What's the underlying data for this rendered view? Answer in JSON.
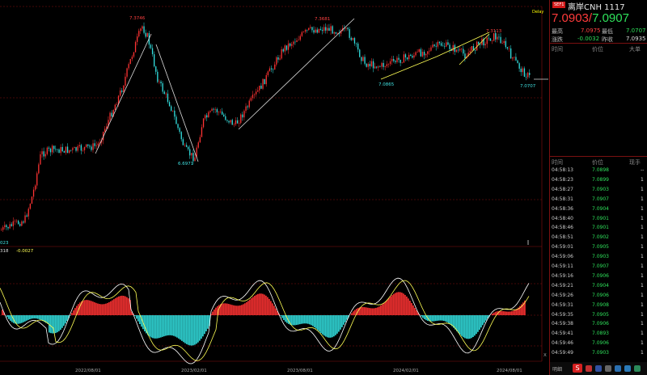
{
  "header": {
    "badge": "SEF1",
    "title": "离岸CNH  1117",
    "price_red": "7.0903",
    "slash": "/",
    "price_green": "7.0907"
  },
  "stats": {
    "high_label": "最高",
    "high_value": "7.0975",
    "low_label": "最低",
    "low_value": "7.0707",
    "change_label": "涨跌",
    "change_value": "-0.0032",
    "prev_close_label": "昨收",
    "prev_close_value": "7.0935"
  },
  "orders_header": {
    "time": "时间",
    "price": "价位",
    "big": "大单"
  },
  "ticks_header": {
    "time": "时间",
    "price": "价位",
    "volume": "现手"
  },
  "ticks": [
    {
      "time": "04:58:13",
      "price": "7.0898",
      "vol": "--"
    },
    {
      "time": "04:58:23",
      "price": "7.0899",
      "vol": "1"
    },
    {
      "time": "04:58:27",
      "price": "7.0903",
      "vol": "1"
    },
    {
      "time": "04:58:31",
      "price": "7.0907",
      "vol": "1"
    },
    {
      "time": "04:58:36",
      "price": "7.0904",
      "vol": "1"
    },
    {
      "time": "04:58:40",
      "price": "7.0901",
      "vol": "1"
    },
    {
      "time": "04:58:46",
      "price": "7.0901",
      "vol": "1"
    },
    {
      "time": "04:58:51",
      "price": "7.0902",
      "vol": "1"
    },
    {
      "time": "04:59:01",
      "price": "7.0905",
      "vol": "1"
    },
    {
      "time": "04:59:06",
      "price": "7.0903",
      "vol": "1"
    },
    {
      "time": "04:59:11",
      "price": "7.0907",
      "vol": "1"
    },
    {
      "time": "04:59:16",
      "price": "7.0906",
      "vol": "1"
    },
    {
      "time": "04:59:21",
      "price": "7.0904",
      "vol": "1"
    },
    {
      "time": "04:59:26",
      "price": "7.0906",
      "vol": "1"
    },
    {
      "time": "04:59:31",
      "price": "7.0908",
      "vol": "1"
    },
    {
      "time": "04:59:35",
      "price": "7.0905",
      "vol": "1"
    },
    {
      "time": "04:59:38",
      "price": "7.0906",
      "vol": "1"
    },
    {
      "time": "04:59:41",
      "price": "7.0893",
      "vol": "1"
    },
    {
      "time": "04:59:46",
      "price": "7.0906",
      "vol": "1"
    },
    {
      "time": "04:59:49",
      "price": "7.0903",
      "vol": "1"
    }
  ],
  "footer": {
    "detail_label": "明细",
    "logo_text": "S"
  },
  "chart": {
    "corner_label": "Delay",
    "price_labels": [
      "7.3746",
      "6.6971",
      "7.3681",
      "7.0865",
      "7.3113",
      "7.0707"
    ],
    "left_edge_label": "023",
    "indicator_label_a": "318",
    "indicator_label_b": "-0.0027",
    "x_ticks": [
      "2022/08/01",
      "2023/02/01",
      "2023/08/01",
      "2024/02/01",
      "2024/08/01"
    ],
    "bottom_left_label": "X",
    "colors": {
      "up": "#ff3333",
      "down": "#33e0e0",
      "trend": "#ffff55",
      "grid": "#8a1010",
      "ma": "#ffffff"
    }
  }
}
